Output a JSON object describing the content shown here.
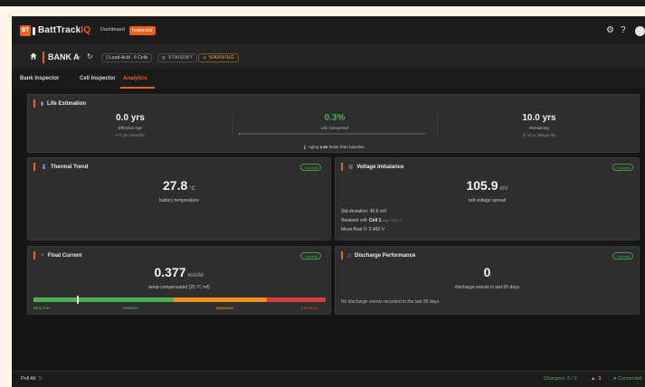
{
  "app": {
    "logo_text": "BT",
    "brand_main": "BattTrack",
    "brand_accent": "IQ",
    "nav": {
      "dashboard": "Dashboard",
      "inspector": "Inspector"
    },
    "icons": [
      "gear-icon",
      "help-icon",
      "user-icon"
    ]
  },
  "bank": {
    "name": "BANK A",
    "chemistry": "Lead-Acid · 6 Cells",
    "state": "STANDBY",
    "warning": "WARNING"
  },
  "tabs": [
    "Bank Inspector",
    "Cell Inspector",
    "Analytics"
  ],
  "active_tab": "Analytics",
  "life": {
    "title": "Life Estimation",
    "effective_age": {
      "value": "0.0 yrs",
      "label": "Effective Age",
      "detail": "0.0 yrs calendar"
    },
    "life_consumed": {
      "value": "0.3%",
      "label": "Life Consumed",
      "fraction": 0.003
    },
    "remaining": {
      "value": "10.0 yrs",
      "label": "Remaining",
      "detail": "of 10 yr design life"
    },
    "aging_prefix": "Aging",
    "aging_value": "1.2x",
    "aging_suffix": "faster than baseline"
  },
  "thermal": {
    "title": "Thermal Trend",
    "badge": "Normal",
    "value": "27.8",
    "unit": "°C",
    "caption": "battery temperature"
  },
  "voltage": {
    "title": "Voltage Imbalance",
    "badge": "Normal",
    "value": "105.9",
    "unit": "mV",
    "caption": "cell voltage spread",
    "std_label": "Std deviation:",
    "std_value": "45.6 mV",
    "weakest_label": "Weakest cell:",
    "weakest_value": "Cell 1",
    "weakest_detail": "avg 2.512 V",
    "mean_label": "Mean float V:",
    "mean_value": "2.400 V"
  },
  "float_current": {
    "title": "Float Current",
    "badge": "Normal",
    "value": "0.377",
    "unit": "mA/Ah",
    "caption": "temp-compensated (25 °C ref)",
    "zones": [
      {
        "label": "HEALTHY",
        "color": "#4caf50"
      },
      {
        "label": "NORMAL",
        "color": "#4caf50"
      },
      {
        "label": "WARNING",
        "color": "#f0901e"
      },
      {
        "label": "CRITICAL",
        "color": "#d93a3a"
      }
    ]
  },
  "discharge": {
    "title": "Discharge Performance",
    "badge": "Normal",
    "value": "0",
    "caption": "discharge events in last 90 days",
    "note": "No discharge events recorded in the last 90 days"
  },
  "status": {
    "poll": "Poll All",
    "chargers": "Chargers: 3 / 3",
    "alerts": "1",
    "connection": "Connected"
  },
  "colors": {
    "accent": "#e8621c",
    "ok": "#4caf50",
    "warn": "#e8a31c",
    "critical": "#d93a3a"
  }
}
